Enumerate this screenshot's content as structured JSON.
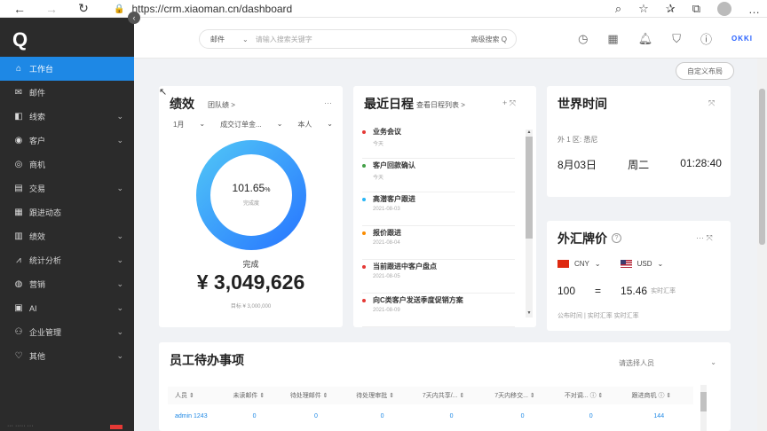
{
  "browser": {
    "url": "https://crm.xiaoman.cn/dashboard",
    "back_icon": "←",
    "forward_icon": "→",
    "reload_icon": "↻",
    "lock_icon": "🔒",
    "more_icon": "…"
  },
  "sidebar": {
    "logo": "Q",
    "collapse_icon": "‹",
    "items": [
      {
        "icon": "⌂",
        "label": "工作台",
        "active": true,
        "chevron": ""
      },
      {
        "icon": "✉",
        "label": "邮件",
        "chevron": ""
      },
      {
        "icon": "◧",
        "label": "线索",
        "chevron": "⌄"
      },
      {
        "icon": "◉",
        "label": "客户",
        "chevron": "⌄"
      },
      {
        "icon": "◎",
        "label": "商机",
        "chevron": ""
      },
      {
        "icon": "▤",
        "label": "交易",
        "chevron": "⌄"
      },
      {
        "icon": "▦",
        "label": "跟进动态",
        "chevron": ""
      },
      {
        "icon": "▥",
        "label": "绩效",
        "chevron": "⌄"
      },
      {
        "icon": "⩘",
        "label": "统计分析",
        "chevron": "⌄"
      },
      {
        "icon": "◍",
        "label": "营销",
        "chevron": "⌄"
      },
      {
        "icon": "▣",
        "label": "AI",
        "chevron": "⌄"
      },
      {
        "icon": "⚇",
        "label": "企业管理",
        "chevron": "⌄"
      },
      {
        "icon": "♡",
        "label": "其他",
        "chevron": "⌄"
      }
    ],
    "footer": "··· ····· ···"
  },
  "topbar": {
    "search_scope": "邮件",
    "search_placeholder": "请输入搜索关键字",
    "search_action": "高级搜索 Q",
    "brand": "OKKI"
  },
  "customize_button": "自定义布局",
  "performance": {
    "title": "绩效",
    "subtitle": "团队绩 >",
    "filters": [
      "1月",
      "⌄",
      "成交订单金...",
      "⌄",
      "本人",
      "⌄"
    ],
    "percent": "101.65",
    "percent_unit": "%",
    "percent_label": "完成度",
    "done_label": "完成",
    "amount": "¥ 3,049,626",
    "target": "目标 ¥ 3,000,000",
    "completion_fraction": 1.0165,
    "ring_color_start": "#2979ff",
    "ring_color_end": "#4fc3f7"
  },
  "schedule": {
    "title": "最近日程",
    "subtitle": "查看日程列表 >",
    "actions": "+ ⤧",
    "items": [
      {
        "name": "业务会议",
        "date": "今天",
        "color": "#e53935"
      },
      {
        "name": "客户回款确认",
        "date": "今天",
        "color": "#43a047"
      },
      {
        "name": "高潜客户跟进",
        "date": "2021-08-03",
        "color": "#29b6f6"
      },
      {
        "name": "报价跟进",
        "date": "2021-08-04",
        "color": "#fb8c00"
      },
      {
        "name": "当前跟进中客户盘点",
        "date": "2021-08-05",
        "color": "#e53935"
      },
      {
        "name": "向C类客户发送季度促销方案",
        "date": "2021-08-09",
        "color": "#e53935"
      }
    ],
    "scroll_up": "▲",
    "scroll_down": "▼"
  },
  "world_time": {
    "title": "世界时间",
    "expand_icon": "⤧",
    "timezone": "外 1 区: 悉尼",
    "date": "8月03日",
    "weekday": "周二",
    "time": "01:28:40"
  },
  "forex": {
    "title": "外汇牌价",
    "help_icon": "?",
    "actions": "··· ⤧",
    "from_currency": "CNY",
    "to_currency": "USD",
    "amount": "100",
    "equals": "=",
    "result": "15.46",
    "result_note": "实时汇率",
    "update_note": "公布时间 | 实时汇率 实时汇率"
  },
  "todo": {
    "title": "员工待办事项",
    "select_placeholder": "请选择人员",
    "select_caret": "⌄",
    "columns": [
      "人员 ⇕",
      "未读邮件 ⇕",
      "待处理邮件 ⇕",
      "待处理审批 ⇕",
      "7天内共享/... ⇕",
      "7天内移交... ⇕",
      "不对调... ⓘ ⇕",
      "跟进商机 ⓘ ⇕"
    ],
    "rows": [
      [
        "admin 1243",
        "0",
        "0",
        "0",
        "0",
        "0",
        "0",
        "144"
      ]
    ]
  }
}
